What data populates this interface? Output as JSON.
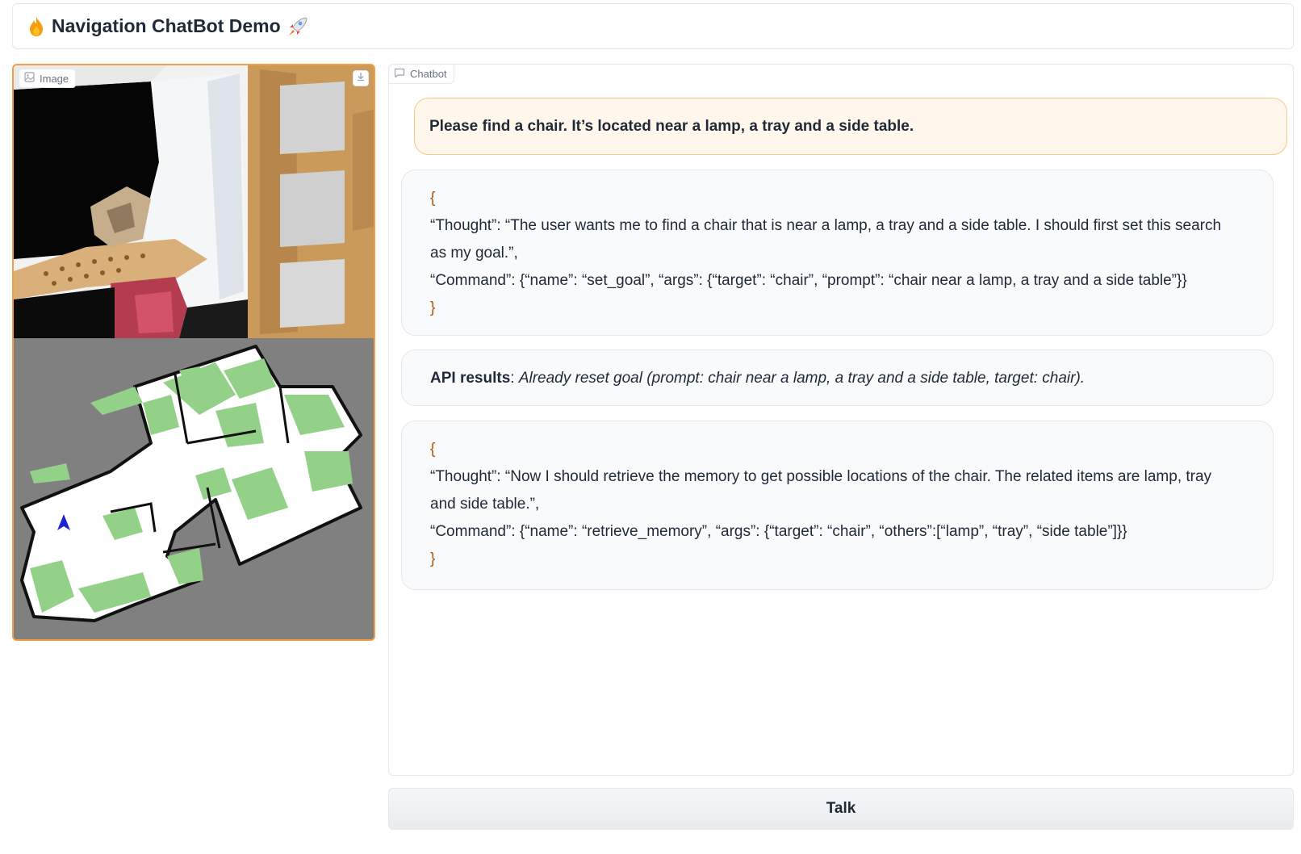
{
  "header": {
    "title": "Navigation ChatBot Demo",
    "left_icon": "fire-icon",
    "right_icon": "rocket-icon"
  },
  "image_panel": {
    "label": "Image",
    "label_icon": "image-icon",
    "download_icon": "download-icon"
  },
  "chat": {
    "label": "Chatbot",
    "label_icon": "chat-icon",
    "messages": [
      {
        "role": "user",
        "text": "Please find a chair. It’s located near a lamp, a tray and a side table."
      },
      {
        "role": "bot",
        "lines": [
          "{",
          "“Thought”: “The user wants me to find a chair that is near a lamp, a tray and a side table. I should first set this search",
          "as my goal.”,",
          "“Command”: {“name”: “set_goal”, “args”: {“target”: “chair”, “prompt”: “chair near a lamp, a tray and a side table”}}",
          "}"
        ]
      },
      {
        "role": "bot",
        "api_label": "API results",
        "api_sep": ": ",
        "api_text": "Already reset goal (prompt: chair near a lamp, a tray and a side table, target: chair)."
      },
      {
        "role": "bot",
        "lines": [
          "{",
          "“Thought”: “Now I should retrieve the memory to get possible locations of the chair. The related items are lamp, tray",
          "and side table.”,",
          "“Command”: {“name”: “retrieve_memory”, “args”: {“target”: “chair”, “others”:[“lamp”, “tray”, “side table”]}}",
          "}"
        ]
      }
    ]
  },
  "talk_button": {
    "label": "Talk"
  },
  "colors": {
    "accent_orange": "#f59e42",
    "user_bubble_bg": "#fff7ec",
    "bot_bubble_bg": "#f9fafb",
    "map_free": "#ffffff",
    "map_explored": "#93d188",
    "map_unknown": "#808080",
    "map_obstacle": "#111111",
    "agent_marker": "#1d24d6"
  }
}
